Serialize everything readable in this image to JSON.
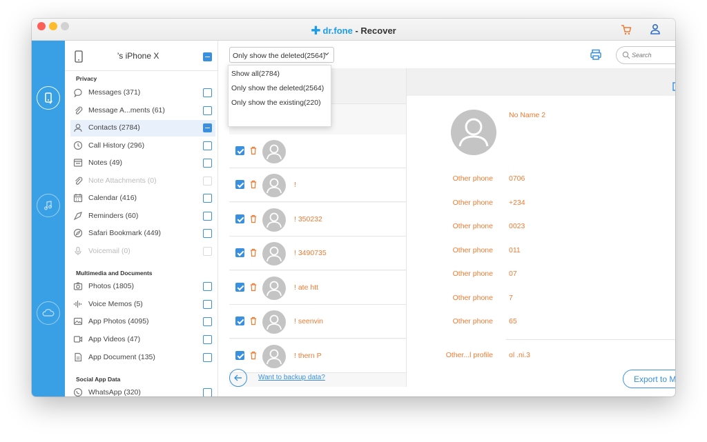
{
  "window": {
    "brand": "dr.fone",
    "separator": " - ",
    "title": "Recover"
  },
  "device": {
    "name": "'s iPhone X"
  },
  "sections": {
    "privacy": "Privacy",
    "multimedia": "Multimedia and Documents",
    "social": "Social App Data"
  },
  "categories": [
    {
      "label": "Messages (371)",
      "icon": "message-icon",
      "state": "unchecked"
    },
    {
      "label": "Message A...ments (61)",
      "icon": "paperclip-icon",
      "state": "unchecked"
    },
    {
      "label": "Contacts (2784)",
      "icon": "contacts-icon",
      "state": "partial"
    },
    {
      "label": "Call History (296)",
      "icon": "clock-icon",
      "state": "unchecked"
    },
    {
      "label": "Notes (49)",
      "icon": "notes-icon",
      "state": "unchecked"
    },
    {
      "label": "Note Attachments (0)",
      "icon": "paperclip-icon",
      "state": "disabled"
    },
    {
      "label": "Calendar (416)",
      "icon": "calendar-icon",
      "state": "unchecked"
    },
    {
      "label": "Reminders (60)",
      "icon": "reminders-icon",
      "state": "unchecked"
    },
    {
      "label": "Safari Bookmark (449)",
      "icon": "compass-icon",
      "state": "unchecked"
    },
    {
      "label": "Voicemail (0)",
      "icon": "microphone-icon",
      "state": "disabled"
    },
    {
      "label": "Photos (1805)",
      "icon": "camera-icon",
      "state": "unchecked"
    },
    {
      "label": "Voice Memos (5)",
      "icon": "waveform-icon",
      "state": "unchecked"
    },
    {
      "label": "App Photos (4095)",
      "icon": "image-icon",
      "state": "unchecked"
    },
    {
      "label": "App Videos (47)",
      "icon": "video-icon",
      "state": "unchecked"
    },
    {
      "label": "App Document (135)",
      "icon": "document-icon",
      "state": "unchecked"
    },
    {
      "label": "WhatsApp (320)",
      "icon": "whatsapp-icon",
      "state": "unchecked"
    }
  ],
  "filter": {
    "selected": "Only show the deleted(2564)",
    "options": [
      "Show all(2784)",
      "Only show the deleted(2564)",
      "Only show the existing(220)"
    ]
  },
  "search": {
    "placeholder": "Search"
  },
  "contacts": [
    {
      "name": "",
      "checked": true
    },
    {
      "name": "!",
      "checked": true
    },
    {
      "name": "!  350232",
      "checked": true
    },
    {
      "name": "!  3490735",
      "checked": true
    },
    {
      "name": "!  ate htt",
      "checked": true
    },
    {
      "name": "!  seenvin",
      "checked": true
    },
    {
      "name": "!  thern P",
      "checked": true
    }
  ],
  "detail": {
    "name": "No Name 2",
    "fields": [
      {
        "label": "Other phone",
        "value": "0706"
      },
      {
        "label": "Other phone",
        "value": "+234"
      },
      {
        "label": "Other phone",
        "value": "0023"
      },
      {
        "label": "Other phone",
        "value": "011"
      },
      {
        "label": "Other phone",
        "value": "07"
      },
      {
        "label": "Other phone",
        "value": "7"
      },
      {
        "label": "Other phone",
        "value": "65"
      },
      {
        "label": "Other...l profile",
        "value": "ol                         .ni.3"
      }
    ]
  },
  "footer": {
    "backup_link": "Want to backup data?",
    "export_label": "Export to Mac"
  },
  "colors": {
    "accent": "#3a90df",
    "rail": "#3aa0e6",
    "deleted_text": "#f07a32"
  }
}
